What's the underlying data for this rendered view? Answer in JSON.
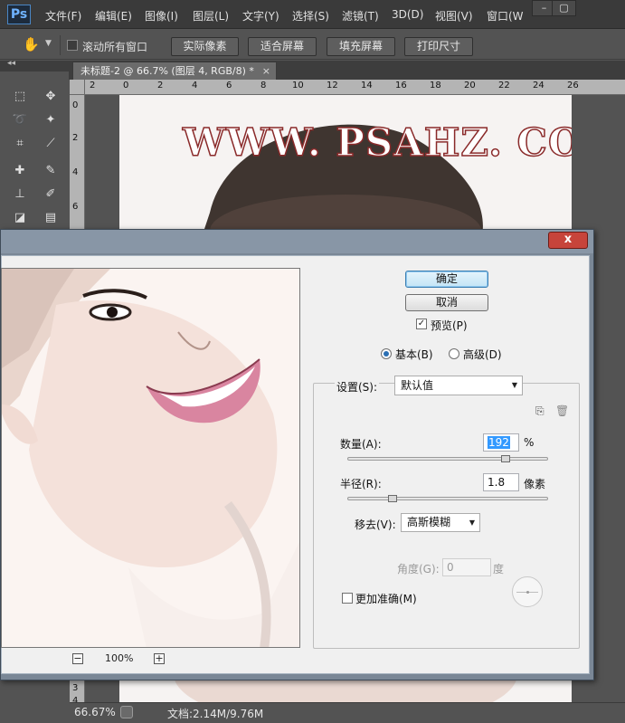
{
  "app": {
    "logo": "Ps"
  },
  "menu": [
    "文件(F)",
    "编辑(E)",
    "图像(I)",
    "图层(L)",
    "文字(Y)",
    "选择(S)",
    "滤镜(T)",
    "3D(D)",
    "视图(V)",
    "窗口(W"
  ],
  "window_controls": {
    "minimize": "–",
    "maximize": "▢"
  },
  "options_bar": {
    "scroll_all_label": "滚动所有窗口",
    "buttons": [
      "实际像素",
      "适合屏幕",
      "填充屏幕",
      "打印尺寸"
    ]
  },
  "document": {
    "tab_title": "未标题-2 @ 66.7% (图层 4, RGB/8) *",
    "close": "×",
    "watermark": "WWW. PSAHZ. COM"
  },
  "rulers": {
    "horizontal": [
      "2",
      "0",
      "2",
      "4",
      "6",
      "8",
      "10",
      "12",
      "14",
      "16",
      "18",
      "20",
      "22",
      "24",
      "26"
    ],
    "vertical": [
      "0",
      "2",
      "4",
      "6",
      "3",
      "4"
    ]
  },
  "status_bar": {
    "zoom": "66.67%",
    "doc_info": "文档:2.14M/9.76M"
  },
  "dialog": {
    "close": "x",
    "ok_label": "确定",
    "cancel_label": "取消",
    "preview_label": "预览(P)",
    "preview_checked": true,
    "mode_basic": "基本(B)",
    "mode_advanced": "高级(D)",
    "mode_selected": "basic",
    "settings_label": "设置(S):",
    "settings_value": "默认值",
    "amount_label": "数量(A):",
    "amount_value": "192",
    "amount_unit": "%",
    "radius_label": "半径(R):",
    "radius_value": "1.8",
    "radius_unit": "像素",
    "remove_label": "移去(V):",
    "remove_value": "高斯模糊",
    "angle_label": "角度(G):",
    "angle_value": "0",
    "angle_unit": "度",
    "more_accurate_label": "更加准确(M)",
    "more_accurate_checked": false,
    "preview_zoom": "100%",
    "zoom_out": "−",
    "zoom_in": "+"
  }
}
